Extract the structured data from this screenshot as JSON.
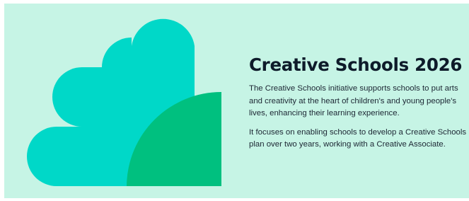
{
  "banner": {
    "title": "Creative Schools 2026",
    "paragraphs": [
      "The Creative Schools initiative supports schools to put arts and creativity at the heart of children's and young people's lives, enhancing their learning experience.",
      "It focuses on enabling schools to develop a Creative Schools plan over two years, working with a Creative Associate."
    ],
    "illustration": {
      "name": "creative-schools-shapes",
      "colors": {
        "background": "#c6f4e5",
        "teal_shape": "#00d8c8",
        "green_shape": "#00c07f"
      }
    }
  }
}
